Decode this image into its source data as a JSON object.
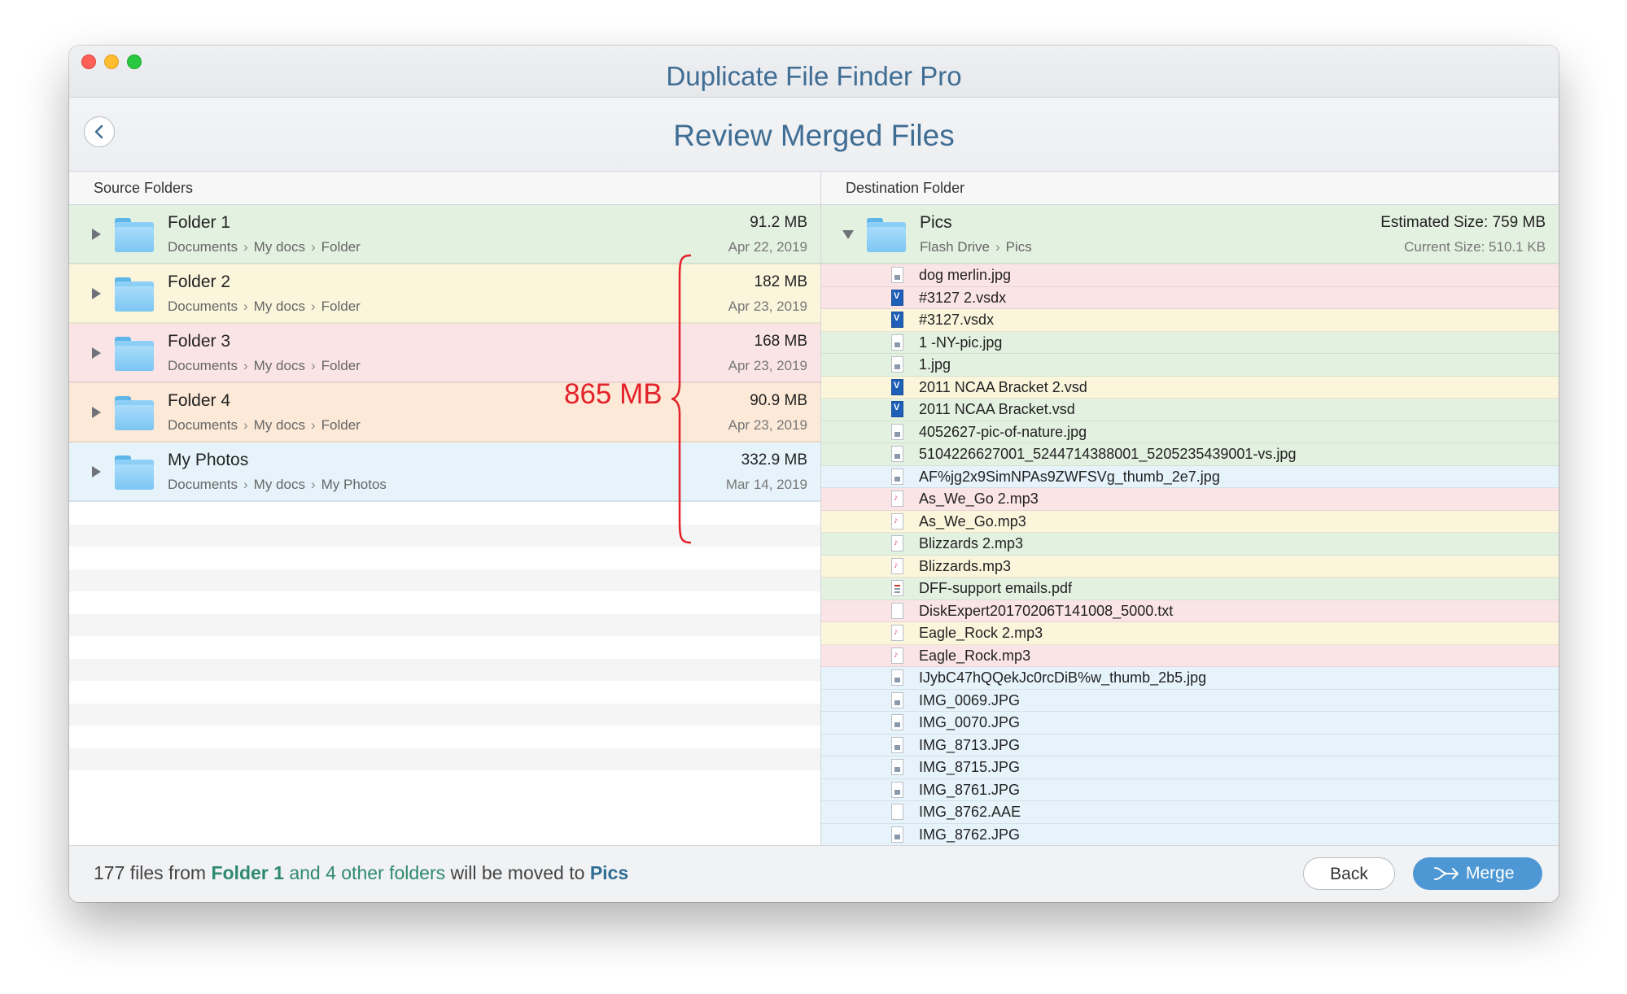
{
  "window": {
    "title": "Duplicate File Finder Pro"
  },
  "header": {
    "title": "Review Merged Files"
  },
  "source": {
    "heading": "Source Folders",
    "folders": [
      {
        "name": "Folder 1",
        "path": [
          "Documents",
          "My docs",
          "Folder"
        ],
        "size": "91.2 MB",
        "date": "Apr 22, 2019",
        "color": "#e3f1e0"
      },
      {
        "name": "Folder 2",
        "path": [
          "Documents",
          "My docs",
          "Folder"
        ],
        "size": "182 MB",
        "date": "Apr 23, 2019",
        "color": "#fbf5dc"
      },
      {
        "name": "Folder 3",
        "path": [
          "Documents",
          "My docs",
          "Folder"
        ],
        "size": "168 MB",
        "date": "Apr 23, 2019",
        "color": "#fbe4e6"
      },
      {
        "name": "Folder 4",
        "path": [
          "Documents",
          "My docs",
          "Folder"
        ],
        "size": "90.9 MB",
        "date": "Apr 23, 2019",
        "color": "#fce9d7"
      },
      {
        "name": "My Photos",
        "path": [
          "Documents",
          "My docs",
          "My Photos"
        ],
        "size": "332.9 MB",
        "date": "Mar 14, 2019",
        "color": "#e6f3fb"
      }
    ],
    "total_annotation": "865 MB",
    "annotation_color": "#e3222a"
  },
  "destination": {
    "heading": "Destination Folder",
    "folder": {
      "name": "Pics",
      "path": [
        "Flash Drive",
        "Pics"
      ],
      "estimated_size": "Estimated Size: 759 MB",
      "current_size": "Current Size: 510.1 KB"
    },
    "files": [
      {
        "name": " dog merlin.jpg",
        "icon": "image-file-icon",
        "bg": "pink"
      },
      {
        "name": "#3127 2.vsdx",
        "icon": "visio-file-icon",
        "bg": "pink"
      },
      {
        "name": "#3127.vsdx",
        "icon": "visio-file-icon",
        "bg": "yellow"
      },
      {
        "name": "1 -NY-pic.jpg",
        "icon": "image-file-icon",
        "bg": "green"
      },
      {
        "name": "1.jpg",
        "icon": "image-file-icon",
        "bg": "green"
      },
      {
        "name": "2011 NCAA Bracket 2.vsd",
        "icon": "visio-file-icon",
        "bg": "yellow"
      },
      {
        "name": "2011 NCAA Bracket.vsd",
        "icon": "visio-file-icon",
        "bg": "green"
      },
      {
        "name": "4052627-pic-of-nature.jpg",
        "icon": "image-file-icon",
        "bg": "green"
      },
      {
        "name": "5104226627001_5244714388001_5205235439001-vs.jpg",
        "icon": "image-file-icon",
        "bg": "green"
      },
      {
        "name": "AF%jg2x9SimNPAs9ZWFSVg_thumb_2e7.jpg",
        "icon": "image-file-icon",
        "bg": "blue"
      },
      {
        "name": "As_We_Go 2.mp3",
        "icon": "audio-file-icon",
        "bg": "pink"
      },
      {
        "name": "As_We_Go.mp3",
        "icon": "audio-file-icon",
        "bg": "yellow"
      },
      {
        "name": "Blizzards 2.mp3",
        "icon": "audio-file-icon",
        "bg": "green"
      },
      {
        "name": "Blizzards.mp3",
        "icon": "audio-file-icon",
        "bg": "yellow"
      },
      {
        "name": "DFF-support emails.pdf",
        "icon": "pdf-file-icon",
        "bg": "green"
      },
      {
        "name": "DiskExpert20170206T141008_5000.txt",
        "icon": "text-file-icon",
        "bg": "pink"
      },
      {
        "name": "Eagle_Rock 2.mp3",
        "icon": "audio-file-icon",
        "bg": "yellow"
      },
      {
        "name": "Eagle_Rock.mp3",
        "icon": "audio-file-icon",
        "bg": "pink"
      },
      {
        "name": "IJybC47hQQekJc0rcDiB%w_thumb_2b5.jpg",
        "icon": "image-file-icon",
        "bg": "blue"
      },
      {
        "name": "IMG_0069.JPG",
        "icon": "image-file-icon",
        "bg": "blue"
      },
      {
        "name": "IMG_0070.JPG",
        "icon": "image-file-icon",
        "bg": "blue"
      },
      {
        "name": "IMG_8713.JPG",
        "icon": "image-file-icon",
        "bg": "blue"
      },
      {
        "name": "IMG_8715.JPG",
        "icon": "image-file-icon",
        "bg": "blue"
      },
      {
        "name": "IMG_8761.JPG",
        "icon": "image-file-icon",
        "bg": "blue"
      },
      {
        "name": "IMG_8762.AAE",
        "icon": "text-file-icon",
        "bg": "blue"
      },
      {
        "name": "IMG_8762.JPG",
        "icon": "image-file-icon",
        "bg": "blue"
      }
    ]
  },
  "footer": {
    "count_text": "177 files from",
    "source_folder": "Folder 1",
    "others_text": "and 4 other folders",
    "moved_text": "will be moved to",
    "destination": "Pics",
    "back_label": "Back",
    "merge_label": "Merge"
  },
  "colors": {
    "title": "#3f6d94",
    "green": "#e3f1e0",
    "yellow": "#fbf5dc",
    "pink": "#fbe4e6",
    "orange": "#fce9d7",
    "blue": "#e6f3fb",
    "merge_button": "#4d98d4"
  }
}
